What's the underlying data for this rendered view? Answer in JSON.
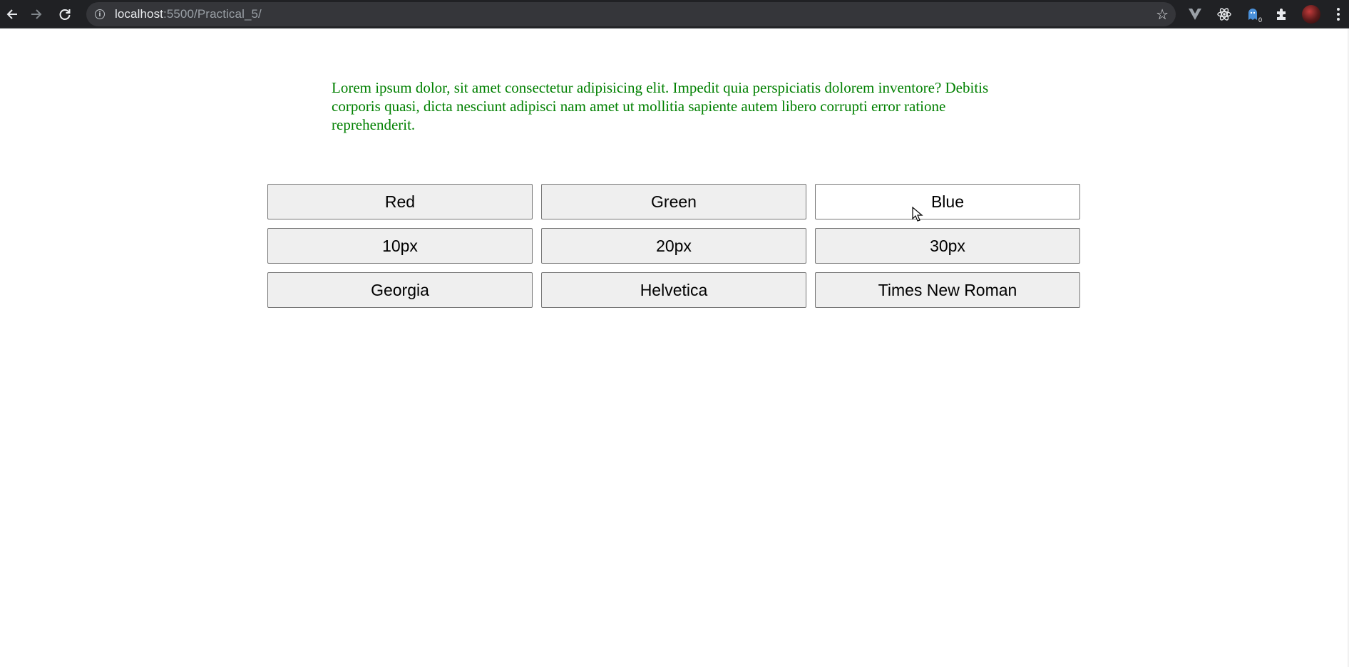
{
  "browser": {
    "url_host": "localhost",
    "url_path": ":5500/Practical_5/",
    "extension_badge": "0"
  },
  "content": {
    "paragraph": "Lorem ipsum dolor, sit amet consectetur adipisicing elit. Impedit quia perspiciatis dolorem inventore? Debitis corporis quasi, dicta nesciunt adipisci nam amet ut mollitia sapiente autem libero corrupti error ratione reprehenderit.",
    "paragraph_color": "#008000",
    "buttons": [
      {
        "label": "Red"
      },
      {
        "label": "Green"
      },
      {
        "label": "Blue"
      },
      {
        "label": "10px"
      },
      {
        "label": "20px"
      },
      {
        "label": "30px"
      },
      {
        "label": "Georgia"
      },
      {
        "label": "Helvetica"
      },
      {
        "label": "Times New Roman"
      }
    ],
    "hovered_button": "Blue"
  }
}
